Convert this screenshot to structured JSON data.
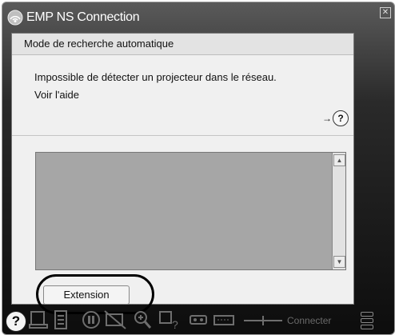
{
  "window": {
    "title": "EMP NS Connection",
    "close_label": "✕"
  },
  "panel": {
    "mode_label": "Mode de recherche automatique",
    "message": "Impossible de détecter un projecteur dans le réseau.",
    "help_link": "Voir l'aide",
    "help_arrow": "→",
    "help_icon_glyph": "?"
  },
  "buttons": {
    "extension_label": "Extension"
  },
  "toolbar": {
    "help_glyph": "?",
    "connect_label": "Connecter",
    "icons": [
      "help-icon",
      "display-icon",
      "list-icon",
      "pause-icon",
      "no-display-icon",
      "zoom-icon",
      "search-icon",
      "connect-plug-icon",
      "keyboard-icon",
      "connect-arrow-icon"
    ]
  },
  "colors": {
    "panel_bg": "#f0f0f0",
    "list_bg": "#a6a6a6",
    "window_dark": "#0d0d0d",
    "disabled_gray": "#6a6a6a"
  }
}
